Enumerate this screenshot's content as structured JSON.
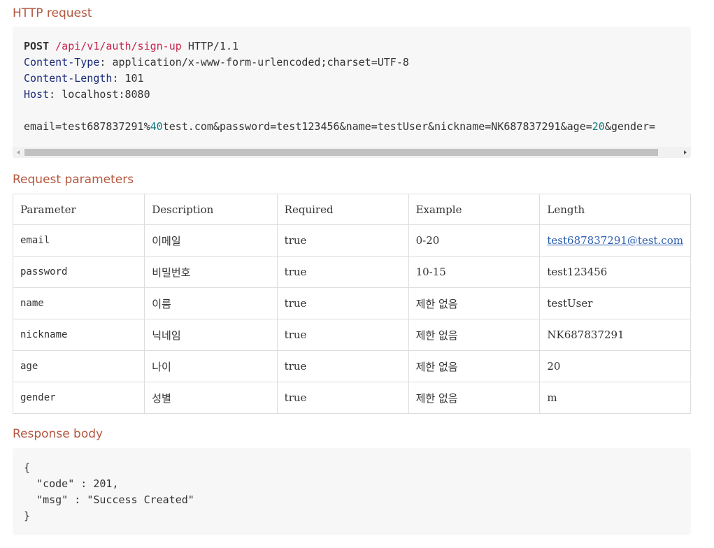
{
  "sections": {
    "http_request": "HTTP request",
    "request_parameters": "Request parameters",
    "response_body": "Response body"
  },
  "http_request": {
    "method": "POST",
    "path": "/api/v1/auth/sign-up",
    "protocol": "HTTP/1.1",
    "headers": [
      {
        "name": "Content-Type",
        "value": "application/x-www-form-urlencoded;charset=UTF-8"
      },
      {
        "name": "Content-Length",
        "value": "101"
      },
      {
        "name": "Host",
        "value": "localhost:8080"
      }
    ],
    "body": {
      "part1": "email=test687837291%",
      "num1": "40",
      "part2": "test.com&password=test123456&name=testUser&nickname=NK687837291&age=",
      "num2": "20",
      "part3": "&gender="
    }
  },
  "params_table": {
    "headers": [
      "Parameter",
      "Description",
      "Required",
      "Example",
      "Length"
    ],
    "rows": [
      {
        "parameter": "email",
        "description": "이메일",
        "required": "true",
        "example": "0-20",
        "length": "test687837291@test.com"
      },
      {
        "parameter": "password",
        "description": "비밀번호",
        "required": "true",
        "example": "10-15",
        "length": "test123456"
      },
      {
        "parameter": "name",
        "description": "이름",
        "required": "true",
        "example": "제한 없음",
        "length": "testUser"
      },
      {
        "parameter": "nickname",
        "description": "닉네임",
        "required": "true",
        "example": "제한 없음",
        "length": "NK687837291"
      },
      {
        "parameter": "age",
        "description": "나이",
        "required": "true",
        "example": "제한 없음",
        "length": "20"
      },
      {
        "parameter": "gender",
        "description": "성별",
        "required": "true",
        "example": "제한 없음",
        "length": "m"
      }
    ]
  },
  "response_body": {
    "open": "{",
    "code_key": "\"code\"",
    "code_value": "201",
    "msg_key": "\"msg\"",
    "msg_value": "\"Success Created\"",
    "close": "}"
  },
  "colors": {
    "section_title": "#b4573f",
    "code_background": "#f7f7f7",
    "path": "#c7254e",
    "header_name": "#1a2a7a",
    "number": "#137b80",
    "link": "#2a5db0"
  }
}
